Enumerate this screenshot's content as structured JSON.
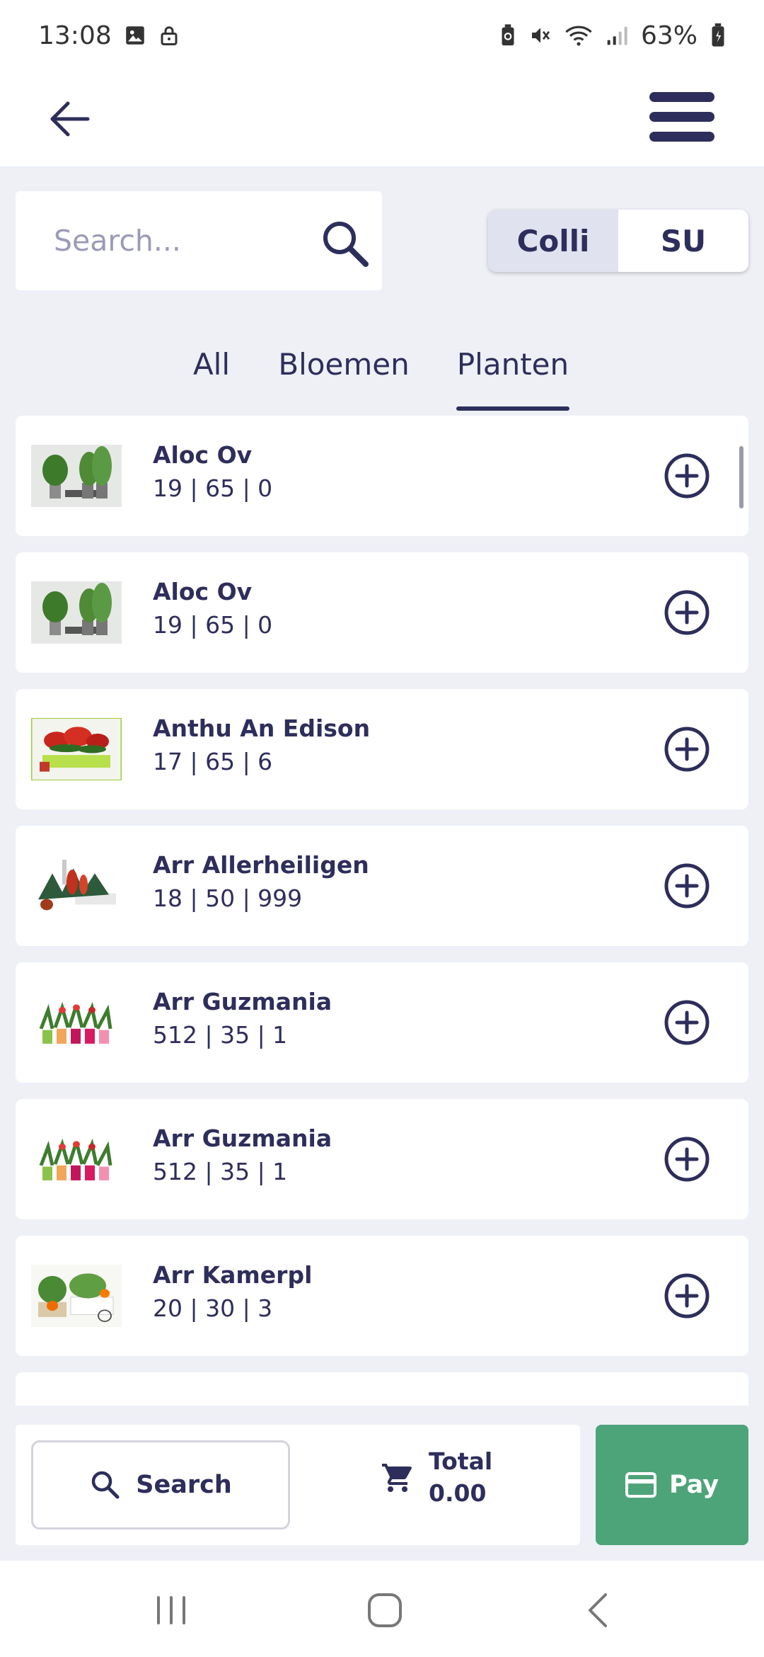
{
  "status_bar": {
    "time": "13:08",
    "battery": "63%"
  },
  "search": {
    "placeholder": "Search..."
  },
  "unit_toggle": {
    "options": [
      "Colli",
      "SU"
    ],
    "selected": "Colli"
  },
  "tabs": [
    {
      "label": "All",
      "active": false
    },
    {
      "label": "Bloemen",
      "active": false
    },
    {
      "label": "Planten",
      "active": true
    }
  ],
  "products": [
    {
      "name": "Aloc Ov",
      "meta": "19  | 65  | 0",
      "image": "green-potted-plants"
    },
    {
      "name": "Aloc Ov",
      "meta": "19  | 65  | 0",
      "image": "green-potted-plants"
    },
    {
      "name": "Anthu An Edison",
      "meta": "17  | 65  | 6",
      "image": "red-anthurium"
    },
    {
      "name": "Arr Allerheiligen",
      "meta": "18  | 50  | 999",
      "image": "arrangement-allerheiligen"
    },
    {
      "name": "Arr Guzmania",
      "meta": "512  | 35  | 1",
      "image": "guzmania-pots"
    },
    {
      "name": "Arr Guzmania",
      "meta": "512  | 35  | 1",
      "image": "guzmania-pots"
    },
    {
      "name": "Arr Kamerpl",
      "meta": "20  | 30  | 3",
      "image": "kamerplant-arrangement"
    }
  ],
  "footer": {
    "search_label": "Search",
    "total_label": "Total",
    "total_value": "0.00",
    "pay_label": "Pay"
  },
  "colors": {
    "primary": "#2e2e5c",
    "pay_green": "#4ea479",
    "background": "#eef0f6",
    "toggle_active": "#e1e2f0"
  },
  "icons": [
    "back-arrow-icon",
    "hamburger-menu-icon",
    "search-icon",
    "add-circle-icon",
    "cart-icon",
    "credit-card-icon",
    "recents-icon",
    "home-icon",
    "back-nav-icon"
  ]
}
